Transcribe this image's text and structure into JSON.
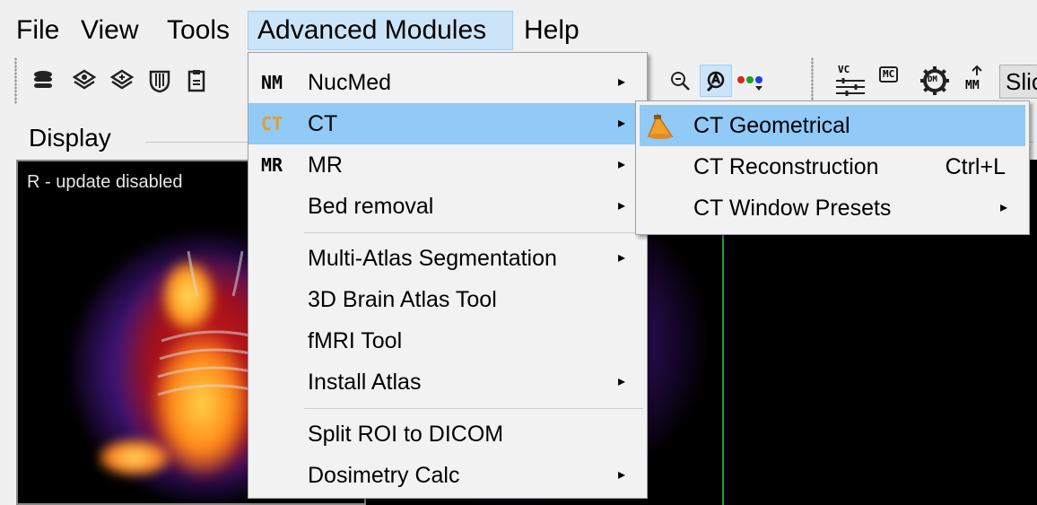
{
  "menubar": {
    "items": [
      {
        "label": "File"
      },
      {
        "label": "View"
      },
      {
        "label": "Tools"
      },
      {
        "label": "Advanced Modules"
      },
      {
        "label": "Help"
      }
    ]
  },
  "toolbar": {
    "badges": [
      "VC",
      "MC",
      "DM",
      "MM"
    ],
    "trailing_text": "Slic"
  },
  "display": {
    "title": "Display",
    "status": "R - update disabled"
  },
  "advanced_menu": {
    "items": [
      {
        "tag": "NM",
        "label": "NucMed",
        "submenu": true
      },
      {
        "tag": "CT",
        "label": "CT",
        "submenu": true,
        "highlighted": true
      },
      {
        "tag": "MR",
        "label": "MR",
        "submenu": true
      },
      {
        "tag": "",
        "label": "Bed removal",
        "submenu": true
      },
      {
        "tag": "",
        "label": "Multi-Atlas Segmentation",
        "submenu": true
      },
      {
        "tag": "",
        "label": "3D Brain Atlas Tool",
        "submenu": false
      },
      {
        "tag": "",
        "label": "fMRI Tool",
        "submenu": false
      },
      {
        "tag": "",
        "label": "Install Atlas",
        "submenu": true
      },
      {
        "tag": "",
        "label": "Split ROI to DICOM",
        "submenu": false
      },
      {
        "tag": "",
        "label": "Dosimetry Calc",
        "submenu": true
      }
    ]
  },
  "ct_submenu": {
    "items": [
      {
        "label": "CT Geometrical",
        "shortcut": "",
        "submenu": false,
        "highlighted": true
      },
      {
        "label": "CT Reconstruction",
        "shortcut": "Ctrl+L",
        "submenu": false
      },
      {
        "label": "CT Window Presets",
        "shortcut": "",
        "submenu": true
      }
    ]
  },
  "colors": {
    "menu_highlight": "#91c9f7",
    "menubar_active": "#cce4f7",
    "ct_tag": "#e89a2c",
    "viewport_bg": "#000000",
    "crosshair": "#2a9d2a"
  },
  "icons": {
    "submenu_arrow": "▸",
    "ct_geometrical": "cone-beam-icon"
  }
}
